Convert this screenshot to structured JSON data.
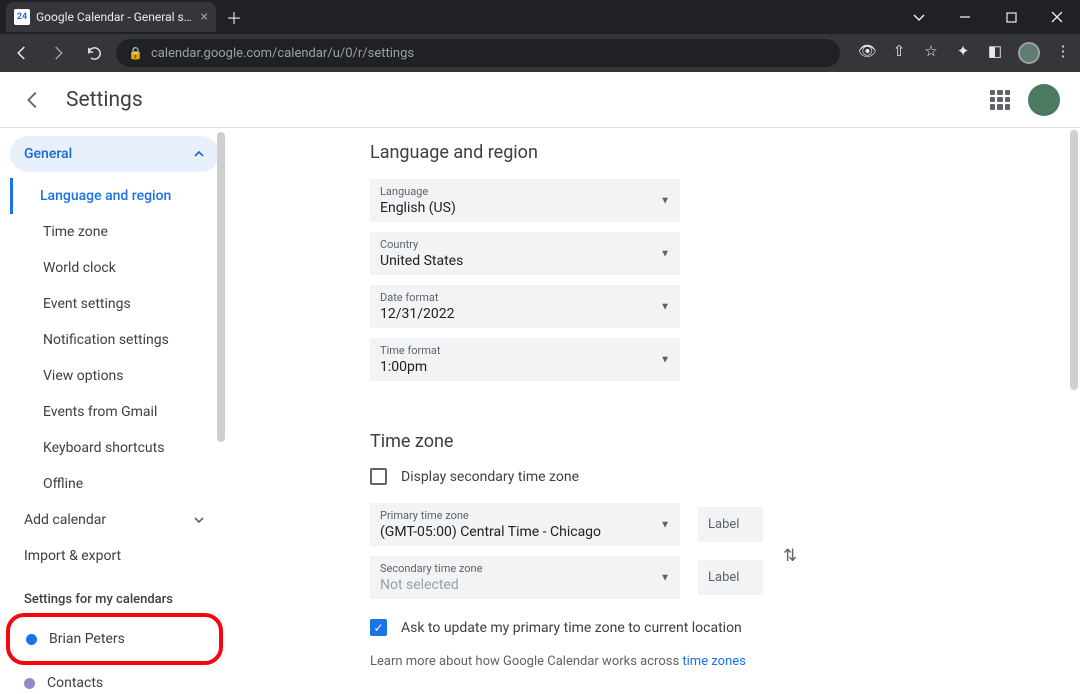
{
  "browser": {
    "tab_title": "Google Calendar - General settin",
    "url": "calendar.google.com/calendar/u/0/r/settings"
  },
  "header": {
    "title": "Settings"
  },
  "sidebar": {
    "general_label": "General",
    "subitems": [
      "Language and region",
      "Time zone",
      "World clock",
      "Event settings",
      "Notification settings",
      "View options",
      "Events from Gmail",
      "Keyboard shortcuts",
      "Offline"
    ],
    "add_calendar": "Add calendar",
    "import_export": "Import & export",
    "section2_header": "Settings for my calendars",
    "cal_items": [
      {
        "label": "Brian Peters",
        "color": "#1a73e8"
      },
      {
        "label": "Contacts",
        "color": "#8e8ec7"
      }
    ]
  },
  "main": {
    "lang_region": {
      "title": "Language and region",
      "language_lbl": "Language",
      "language_val": "English (US)",
      "country_lbl": "Country",
      "country_val": "United States",
      "dateformat_lbl": "Date format",
      "dateformat_val": "12/31/2022",
      "timeformat_lbl": "Time format",
      "timeformat_val": "1:00pm"
    },
    "timezone": {
      "title": "Time zone",
      "display_secondary": "Display secondary time zone",
      "primary_lbl": "Primary time zone",
      "primary_val": "(GMT-05:00) Central Time - Chicago",
      "secondary_lbl": "Secondary time zone",
      "secondary_val": "Not selected",
      "label_placeholder": "Label",
      "ask_update": "Ask to update my primary time zone to current location",
      "learn_more_prefix": "Learn more about how Google Calendar works across ",
      "learn_more_link": "time zones"
    }
  }
}
